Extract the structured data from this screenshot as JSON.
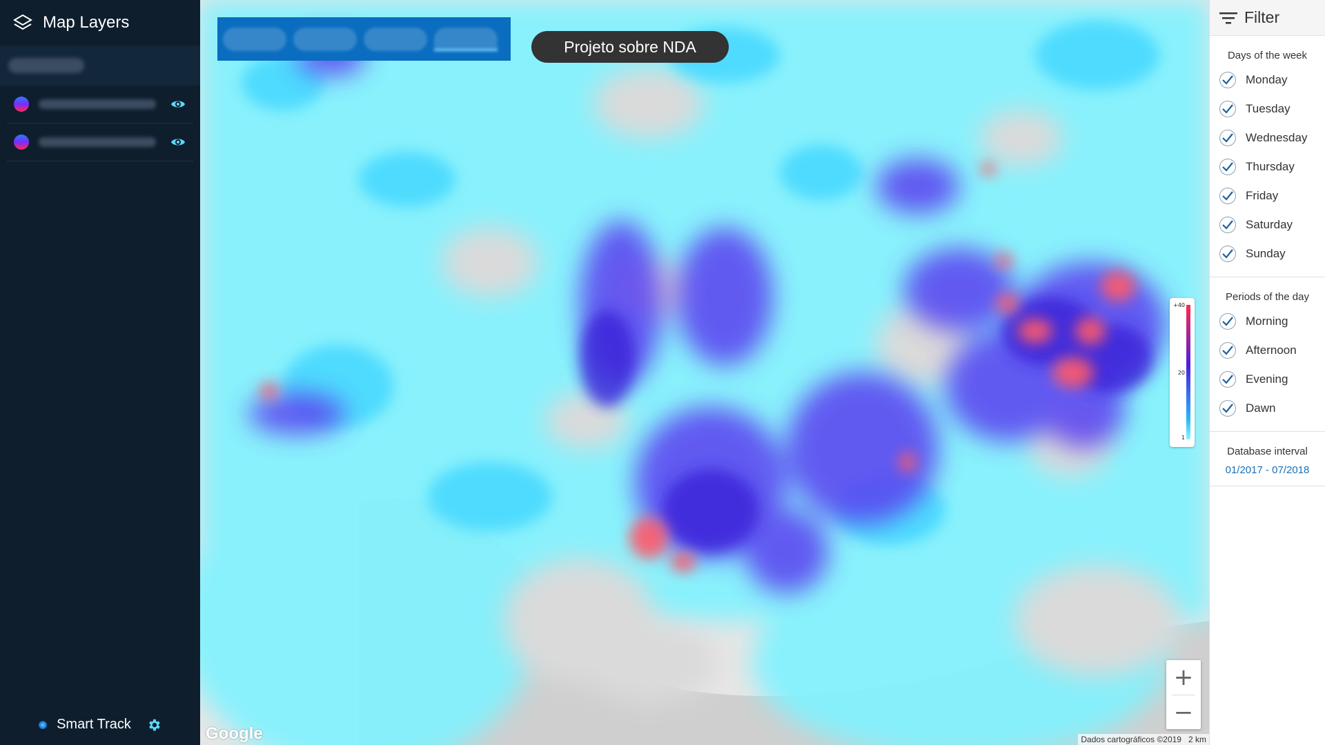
{
  "sidebar": {
    "title": "Map Layers",
    "layers": [
      {
        "visibility_icon": "eye-icon"
      },
      {
        "visibility_icon": "eye-icon"
      }
    ],
    "footer_label": "Smart Track"
  },
  "map": {
    "project_label": "Projeto sobre NDA",
    "legend": {
      "max": "+40",
      "mid": "20",
      "min": "1"
    },
    "zoom_in": "+",
    "zoom_out": "−",
    "google": "Google",
    "attribution": "Dados cartográficos ©2019",
    "scale": "2 km"
  },
  "filter": {
    "title": "Filter",
    "days_title": "Days of the week",
    "days": [
      {
        "label": "Monday",
        "checked": true
      },
      {
        "label": "Tuesday",
        "checked": true
      },
      {
        "label": "Wednesday",
        "checked": true
      },
      {
        "label": "Thursday",
        "checked": true
      },
      {
        "label": "Friday",
        "checked": true
      },
      {
        "label": "Saturday",
        "checked": true
      },
      {
        "label": "Sunday",
        "checked": true
      }
    ],
    "periods_title": "Periods of the day",
    "periods": [
      {
        "label": "Morning",
        "checked": true
      },
      {
        "label": "Afternoon",
        "checked": true
      },
      {
        "label": "Evening",
        "checked": true
      },
      {
        "label": "Dawn",
        "checked": true
      }
    ],
    "db_interval_title": "Database interval",
    "db_interval_value": "01/2017 - 07/2018"
  },
  "colors": {
    "sidebar_bg": "#0f1e2d",
    "accent_blue": "#0a6dbf",
    "heat_low": "#5ff0ff",
    "heat_mid": "#5a3ff0",
    "heat_high": "#ff5a6a"
  }
}
